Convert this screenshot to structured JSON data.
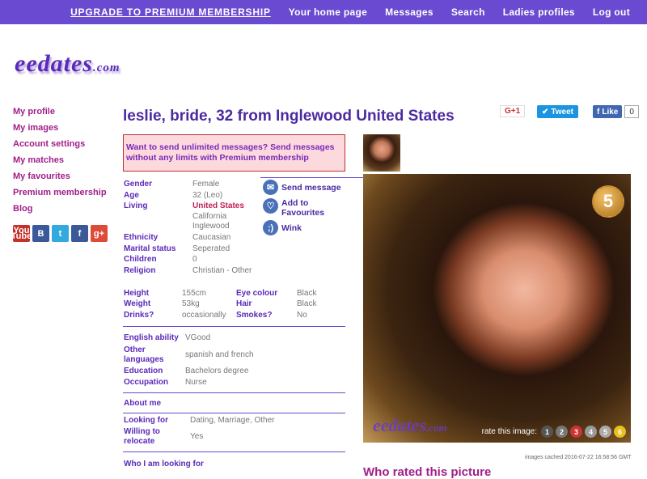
{
  "nav": {
    "upgrade": "UPGRADE TO PREMIUM MEMBERSHIP",
    "home": "Your home page",
    "messages": "Messages",
    "search": "Search",
    "ladies": "Ladies profiles",
    "logout": "Log out"
  },
  "logo": {
    "main": "eedates",
    "suffix": ".com"
  },
  "sidebar": [
    "My profile",
    "My images",
    "Account settings",
    "My matches",
    "My favourites",
    "Premium membership",
    "Blog"
  ],
  "social_icons": [
    {
      "icon": "youtube-icon",
      "label": "You Tube",
      "color": "#c4302b"
    },
    {
      "icon": "blogger-icon",
      "label": "B",
      "color": "#3b5998"
    },
    {
      "icon": "twitter-icon",
      "label": "t",
      "color": "#33aadd"
    },
    {
      "icon": "facebook-icon",
      "label": "f",
      "color": "#3b5998"
    },
    {
      "icon": "googleplus-icon",
      "label": "g+",
      "color": "#dd4b39"
    }
  ],
  "profile": {
    "title": "leslie, bride, 32 from Inglewood United States",
    "promo": "Want to send unlimited messages? Send messages without any limits with Premium membership",
    "gender_label": "Gender",
    "gender": "Female",
    "age_label": "Age",
    "age": "32 (Leo)",
    "living_label": "Living",
    "living_country": "United States",
    "living_state": "California",
    "living_city": "Inglewood",
    "ethnicity_label": "Ethnicity",
    "ethnicity": "Caucasian",
    "marital_label": "Marital status",
    "marital": "Seperated",
    "children_label": "Children",
    "children": "0",
    "religion_label": "Religion",
    "religion": "Christian - Other",
    "height_label": "Height",
    "height": "155cm",
    "weight_label": "Weight",
    "weight": "53kg",
    "drinks_label": "Drinks?",
    "drinks": "occasionally",
    "eye_label": "Eye colour",
    "eye": "Black",
    "hair_label": "Hair",
    "hair": "Black",
    "smokes_label": "Smokes?",
    "smokes": "No",
    "english_label": "English ability",
    "english": "VGood",
    "other_lang_label_1": "Other",
    "other_lang_label_2": "languages",
    "other_lang": "spanish and french",
    "education_label": "Education",
    "education": "Bachelors degree",
    "occupation_label": "Occupation",
    "occupation": "Nurse",
    "about_label": "About me",
    "looking_label": "Looking for",
    "looking": "Dating, Marriage, Other",
    "relocate_label_1": "Willing to",
    "relocate_label_2": "relocate",
    "relocate": "Yes",
    "who_label": "Who I am looking for"
  },
  "actions": {
    "send_message": "Send message",
    "add_fav_1": "Add to",
    "add_fav_2": "Favourites",
    "wink": "Wink"
  },
  "share": {
    "gplus": "G+1",
    "tweet": "Tweet",
    "like": "Like",
    "like_count": "0"
  },
  "photo": {
    "badge": "5",
    "watermark": "eedates",
    "watermark_suffix": ".com",
    "rate_text": "rate this image:",
    "rate_values": [
      "1",
      "2",
      "3",
      "4",
      "5",
      "6"
    ],
    "rate_colors": [
      "#555555",
      "#777777",
      "#cc3333",
      "#999999",
      "#aaaaaa",
      "#e8c020"
    ]
  },
  "cached": "images cached 2016-07-22 16:58:56 GMT",
  "who_rated": "Who rated this picture"
}
